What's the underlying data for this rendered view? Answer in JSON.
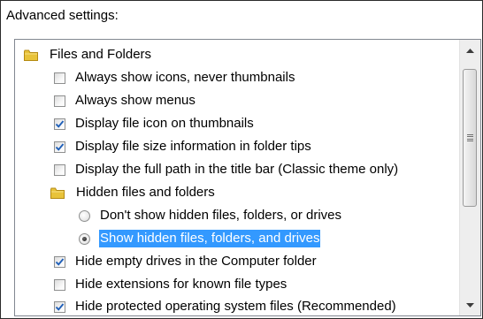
{
  "section_label": "Advanced settings:",
  "tree": {
    "folder_files": {
      "label": "Files and Folders"
    },
    "always_icons": {
      "label": "Always show icons, never thumbnails",
      "checked": false
    },
    "always_menus": {
      "label": "Always show menus",
      "checked": false
    },
    "file_icon_thumbnails": {
      "label": "Display file icon on thumbnails",
      "checked": true
    },
    "file_size_tips": {
      "label": "Display file size information in folder tips",
      "checked": true
    },
    "full_path": {
      "label": "Display the full path in the title bar (Classic theme only)",
      "checked": false
    },
    "folder_hidden": {
      "label": "Hidden files and folders"
    },
    "radio_dont_show": {
      "label": "Don't show hidden files, folders, or drives",
      "selected": false
    },
    "radio_show": {
      "label": "Show hidden files, folders, and drives",
      "selected": true
    },
    "hide_empty_drives": {
      "label": "Hide empty drives in the Computer folder",
      "checked": true
    },
    "hide_extensions": {
      "label": "Hide extensions for known file types",
      "checked": false
    },
    "hide_protected": {
      "label": "Hide protected operating system files (Recommended)",
      "checked": true
    }
  },
  "scrollbar": {
    "position": 0.0,
    "up_icon": "arrow-up-icon",
    "down_icon": "arrow-down-icon"
  },
  "colors": {
    "selection": "#3399ff",
    "check": "#1f5fb8",
    "folder": "#e8c33a"
  }
}
